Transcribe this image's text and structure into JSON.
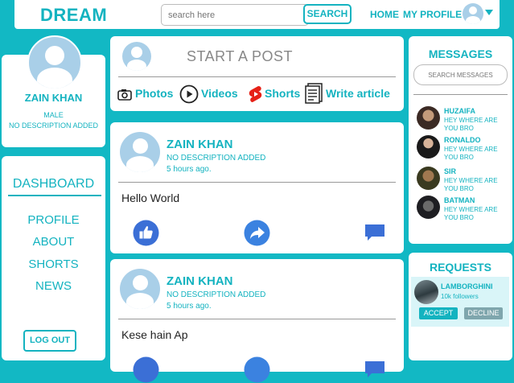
{
  "header": {
    "logo": "DREAM",
    "search_placeholder": "search here",
    "search_button": "SEARCH",
    "nav_home": "HOME",
    "nav_profile": "MY PROFILE"
  },
  "profile": {
    "name": "ZAIN KHAN",
    "gender": "MALE",
    "description": "NO DESCRIPTION ADDED"
  },
  "dashboard": {
    "title": "DASHBOARD",
    "items": [
      "PROFILE",
      "ABOUT",
      "SHORTS",
      "NEWS"
    ],
    "logout": "LOG OUT"
  },
  "composer": {
    "placeholder": "START A POST",
    "actions": [
      "Photos",
      "Videos",
      "Shorts",
      "Write article"
    ]
  },
  "posts": [
    {
      "name": "ZAIN KHAN",
      "description": "NO DESCRIPTION ADDED",
      "time": "5 hours ago.",
      "text": "Hello World"
    },
    {
      "name": "ZAIN KHAN",
      "description": "NO DESCRIPTION ADDED",
      "time": "5 hours ago.",
      "text": "Kese hain Ap"
    }
  ],
  "messages": {
    "title": "MESSAGES",
    "search_placeholder": "SEARCH MESSAGES",
    "items": [
      {
        "name": "HUZAIFA",
        "text": "HEY WHERE ARE YOU BRO"
      },
      {
        "name": "RONALDO",
        "text": "HEY WHERE ARE YOU BRO"
      },
      {
        "name": "SIR",
        "text": "HEY WHERE ARE YOU BRO"
      },
      {
        "name": "BATMAN",
        "text": "HEY WHERE ARE YOU BRO"
      }
    ]
  },
  "requests": {
    "title": "REQUESTS",
    "name": "LAMBORGHINI",
    "followers": "10k followers",
    "accept": "ACCEPT",
    "decline": "DECLINE"
  },
  "colors": {
    "background": "#12b8c4",
    "accent": "#14b3c0",
    "like_blue": "#3b6fd6"
  }
}
